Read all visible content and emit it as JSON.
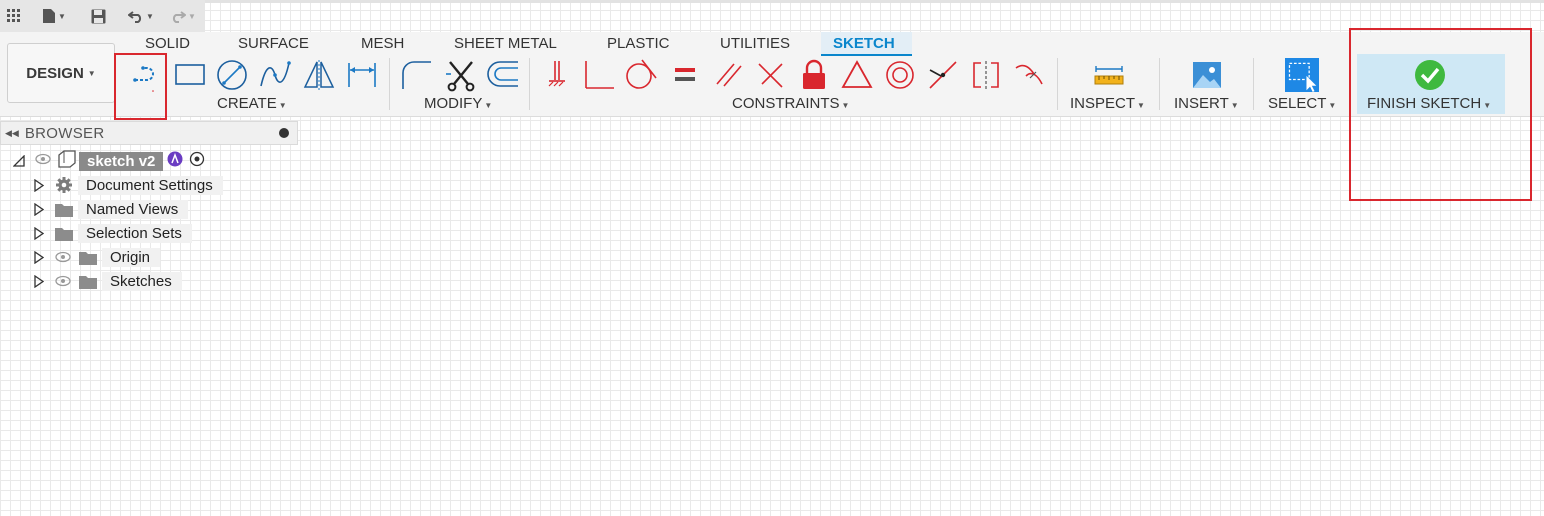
{
  "colors": {
    "accent": "#0a86cc",
    "constraint_red": "#d9272e",
    "sketch_blue": "#1c79c4",
    "finish_green": "#3fb93f",
    "highlight_box": "#d9272e"
  },
  "quick_access": {
    "icons": [
      "grid-icon",
      "file-icon",
      "save-icon",
      "undo-icon",
      "redo-icon"
    ]
  },
  "workspace": {
    "label": "DESIGN"
  },
  "tabs": [
    {
      "label": "SOLID"
    },
    {
      "label": "SURFACE"
    },
    {
      "label": "MESH"
    },
    {
      "label": "SHEET METAL"
    },
    {
      "label": "PLASTIC"
    },
    {
      "label": "UTILITIES"
    },
    {
      "label": "SKETCH",
      "active": true
    }
  ],
  "groups": {
    "create": "CREATE",
    "modify": "MODIFY",
    "constraints": "CONSTRAINTS",
    "inspect": "INSPECT",
    "insert": "INSERT",
    "select": "SELECT",
    "finish": "FINISH SKETCH"
  },
  "browser": {
    "title": "BROWSER",
    "root": "sketch v2",
    "items": [
      {
        "label": "Document Settings",
        "icon": "gear-icon"
      },
      {
        "label": "Named Views",
        "icon": "folder-icon"
      },
      {
        "label": "Selection Sets",
        "icon": "folder-icon"
      },
      {
        "label": "Origin",
        "icon": "folder-icon"
      },
      {
        "label": "Sketches",
        "icon": "folder-icon"
      }
    ]
  }
}
